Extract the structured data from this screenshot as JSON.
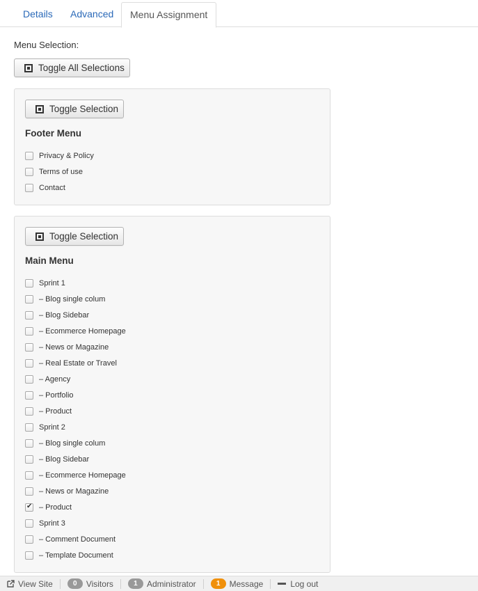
{
  "tabs": [
    {
      "label": "Details"
    },
    {
      "label": "Advanced"
    },
    {
      "label": "Menu Assignment",
      "active": true
    }
  ],
  "menu_selection_label": "Menu Selection:",
  "toggle_all_label": "Toggle All Selections",
  "menus": [
    {
      "toggle_label": "Toggle Selection",
      "title": "Footer Menu",
      "items": [
        {
          "label": "Privacy & Policy",
          "checked": false
        },
        {
          "label": "Terms of use",
          "checked": false
        },
        {
          "label": "Contact",
          "checked": false
        }
      ]
    },
    {
      "toggle_label": "Toggle Selection",
      "title": "Main Menu",
      "items": [
        {
          "label": "Sprint 1",
          "checked": false
        },
        {
          "label": "– Blog single colum",
          "checked": false
        },
        {
          "label": "– Blog Sidebar",
          "checked": false
        },
        {
          "label": "– Ecommerce Homepage",
          "checked": false
        },
        {
          "label": "– News or Magazine",
          "checked": false
        },
        {
          "label": "– Real Estate or Travel",
          "checked": false
        },
        {
          "label": "– Agency",
          "checked": false
        },
        {
          "label": "– Portfolio",
          "checked": false
        },
        {
          "label": "– Product",
          "checked": false
        },
        {
          "label": "Sprint 2",
          "checked": false
        },
        {
          "label": "– Blog single colum",
          "checked": false
        },
        {
          "label": "– Blog Sidebar",
          "checked": false
        },
        {
          "label": "– Ecommerce Homepage",
          "checked": false
        },
        {
          "label": "– News or Magazine",
          "checked": false
        },
        {
          "label": "– Product",
          "checked": true
        },
        {
          "label": "Sprint 3",
          "checked": false
        },
        {
          "label": "– Comment Document",
          "checked": false
        },
        {
          "label": "– Template Document",
          "checked": false
        }
      ]
    }
  ],
  "statusbar": {
    "view_site": "View Site",
    "visitors_count": "0",
    "visitors_label": "Visitors",
    "admin_count": "1",
    "admin_label": "Administrator",
    "message_count": "1",
    "message_label": "Message",
    "logout_label": "Log out"
  },
  "colors": {
    "link": "#2a69b8",
    "message_badge": "#f0900a",
    "neutral_badge": "#999999"
  },
  "icons": [
    "toggle-square-icon",
    "external-link-icon",
    "minus-icon"
  ]
}
